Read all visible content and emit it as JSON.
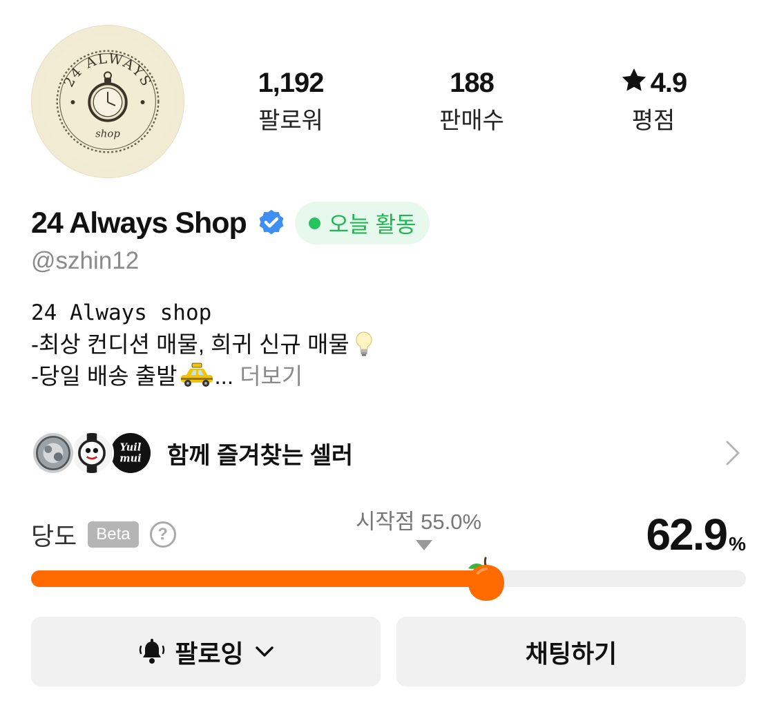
{
  "profile": {
    "avatar_text_top": "24 ALWAYS",
    "avatar_text_bottom": "shop",
    "name": "24 Always Shop",
    "handle": "@szhin12",
    "activity_badge": "오늘 활동",
    "verified_icon": "verified-badge-icon",
    "colors": {
      "badge_bg": "#e7f8ec",
      "badge_text": "#22b455",
      "verified": "#3d8ef5"
    }
  },
  "stats": [
    {
      "value": "1,192",
      "label": "팔로워"
    },
    {
      "value": "188",
      "label": "판매수"
    },
    {
      "value": "4.9",
      "label": "평점",
      "icon": "star-icon"
    }
  ],
  "bio": {
    "line1": "24 Always shop",
    "line2": "-최상 컨디션 매물, 희귀 신규 매물",
    "line3": "-당일 배송 출발",
    "ellipsis": "...",
    "more": "더보기"
  },
  "sellers": {
    "label": "함께 즐겨찾는 셀러",
    "third_thumb_text": "Yuil mui"
  },
  "sweetness": {
    "title": "당도",
    "beta": "Beta",
    "help": "?",
    "start_label": "시작점 55.0%",
    "start_point": 55.0,
    "value": "62.9",
    "value_number": 62.9,
    "unit": "%",
    "colors": {
      "fill": "#ff6b00",
      "track": "#efefef"
    }
  },
  "buttons": {
    "follow": "팔로잉",
    "chat": "채팅하기"
  }
}
